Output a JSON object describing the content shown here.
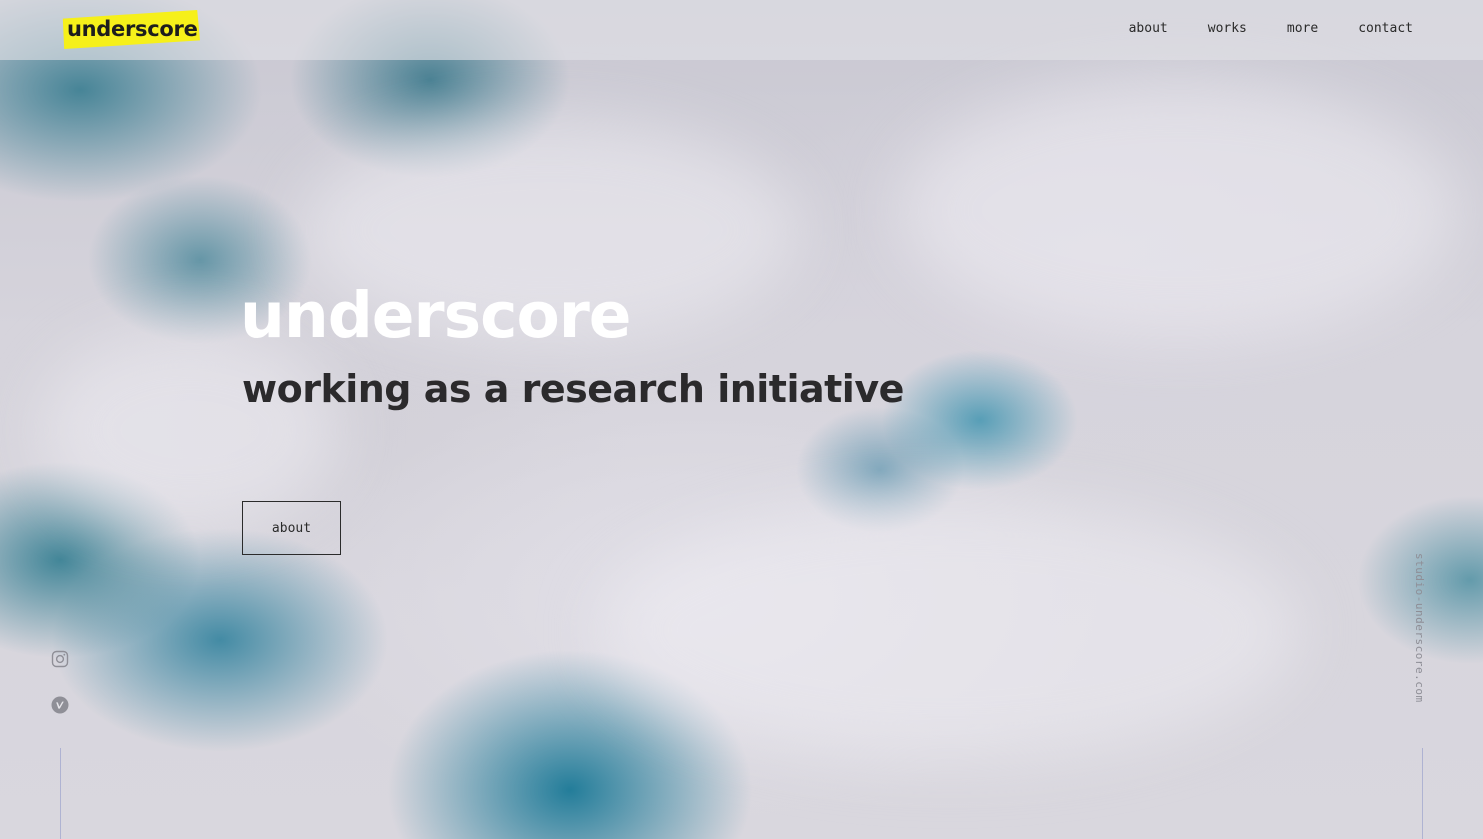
{
  "header": {
    "logo_text": "underscore",
    "nav": [
      {
        "label": "about"
      },
      {
        "label": "works"
      },
      {
        "label": "more"
      },
      {
        "label": "contact"
      }
    ]
  },
  "hero": {
    "title": "underscore",
    "subtitle": "working as a research initiative",
    "button_label": "about"
  },
  "social": [
    {
      "icon": "instagram-icon"
    },
    {
      "icon": "vimeo-icon"
    }
  ],
  "side_text": "studio-underscore.com",
  "colors": {
    "logo_bg": "#f6f01a",
    "text_dark": "#2b2a2c",
    "title_white": "#ffffff",
    "side_line": "#8c96c8"
  }
}
